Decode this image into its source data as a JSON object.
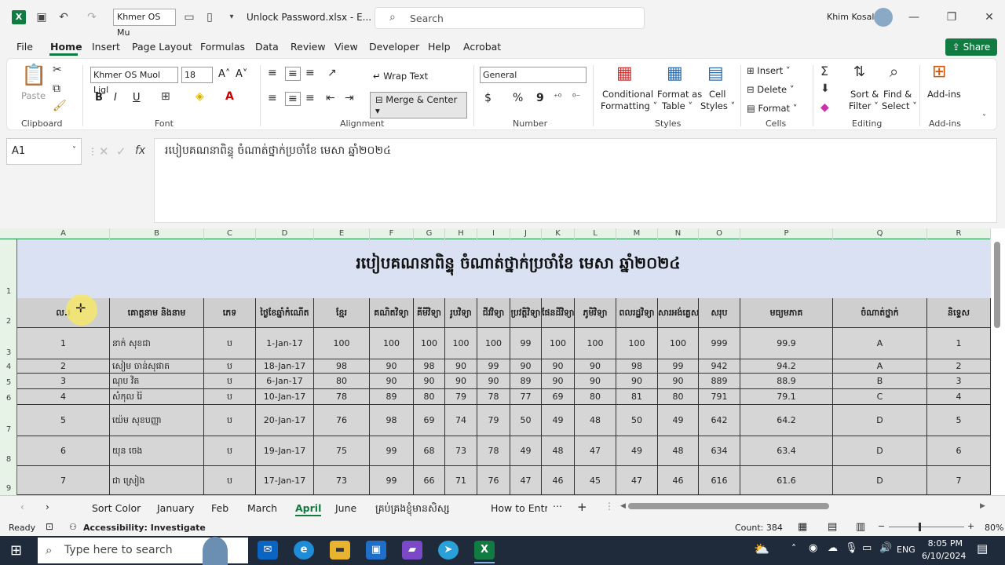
{
  "titlebar": {
    "font_name": "Khmer OS Mu",
    "file_name": "Unlock Password.xlsx",
    "file_suffix": "- E...",
    "search_placeholder": "Search",
    "user": "Khim Kosal"
  },
  "menu": [
    "File",
    "Home",
    "Insert",
    "Page Layout",
    "Formulas",
    "Data",
    "Review",
    "View",
    "Developer",
    "Help",
    "Acrobat"
  ],
  "share_label": "Share",
  "ribbon": {
    "clipboard": {
      "paste": "Paste",
      "label": "Clipboard"
    },
    "font": {
      "name": "Khmer OS Muol Ligl",
      "size": "18",
      "bold": "B",
      "italic": "I",
      "underline": "U",
      "label": "Font"
    },
    "alignment": {
      "wrap": "Wrap Text",
      "merge": "Merge & Center",
      "label": "Alignment"
    },
    "number": {
      "format": "General",
      "currency": "$",
      "percent": "%",
      "comma": "9",
      "label": "Number"
    },
    "styles": {
      "conditional": "Conditional",
      "formatting": "Formatting",
      "format_as": "Format as",
      "table": "Table",
      "cell": "Cell",
      "styles": "Styles",
      "label": "Styles"
    },
    "cells": {
      "insert": "Insert",
      "delete": "Delete",
      "format": "Format",
      "label": "Cells"
    },
    "editing": {
      "sort": "Sort &",
      "filter": "Filter",
      "find": "Find &",
      "select": "Select",
      "label": "Editing"
    },
    "addins": {
      "name": "Add-ins",
      "label": "Add-ins"
    }
  },
  "formula_bar": {
    "cell_ref": "A1",
    "fx": "fx",
    "content": "របៀបគណនាពិន្ទុ ចំណាត់ថ្នាក់ប្រចាំខែ មេសា ឆ្នាំ២០២៤"
  },
  "sheet": {
    "columns": [
      "A",
      "B",
      "C",
      "D",
      "E",
      "F",
      "G",
      "H",
      "I",
      "J",
      "K",
      "L",
      "M",
      "N",
      "O",
      "P",
      "Q",
      "R"
    ],
    "row_numbers": [
      "1",
      "2",
      "3",
      "4",
      "5",
      "6",
      "7",
      "8",
      "9"
    ],
    "title": "របៀបគណនាពិន្ទុ ចំណាត់ថ្នាក់ប្រចាំខែ មេសា ឆ្នាំ២០២៤",
    "headers": [
      "ល.រ",
      "គោត្តនាម និងនាម",
      "ភេទ",
      "ថ្ងៃខែឆ្នាំកំណើត",
      "ខ្មែរ",
      "គណិតវិទ្យា",
      "គីមីវិទ្យា",
      "រូបវិទ្យា",
      "ជីវវិទ្យា",
      "ប្រវត្តិវិទ្យា",
      "ផែនដីវិទ្យា",
      "ភូមិវិទ្យា",
      "ពលរដ្ឋវិទ្យា",
      "សារអង់គ្លេស",
      "សរុប",
      "មធ្យមភាគ",
      "ចំណាត់ថ្នាក់",
      "និទ្ទេស"
    ],
    "rows": [
      [
        "1",
        "នាក់ សុខជា",
        "ប",
        "1-Jan-17",
        "100",
        "100",
        "100",
        "100",
        "100",
        "99",
        "100",
        "100",
        "100",
        "100",
        "999",
        "99.9",
        "A",
        "1"
      ],
      [
        "2",
        "សៀម ចាន់សុផាត",
        "ប",
        "18-Jan-17",
        "98",
        "90",
        "98",
        "90",
        "99",
        "90",
        "90",
        "90",
        "98",
        "99",
        "942",
        "94.2",
        "A",
        "2"
      ],
      [
        "3",
        "ណុប វិត",
        "ប",
        "6-Jan-17",
        "80",
        "90",
        "90",
        "90",
        "90",
        "89",
        "90",
        "90",
        "90",
        "90",
        "889",
        "88.9",
        "B",
        "3"
      ],
      [
        "4",
        "សំកុល រ៉ៃ",
        "ប",
        "10-Jan-17",
        "78",
        "89",
        "80",
        "79",
        "78",
        "77",
        "69",
        "80",
        "81",
        "80",
        "791",
        "79.1",
        "C",
        "4"
      ],
      [
        "5",
        "យ៉េម សុខបញ្ញា",
        "ប",
        "20-Jan-17",
        "76",
        "98",
        "69",
        "74",
        "79",
        "50",
        "49",
        "48",
        "50",
        "49",
        "642",
        "64.2",
        "D",
        "5"
      ],
      [
        "6",
        "យុន ចេង",
        "ប",
        "19-Jan-17",
        "75",
        "99",
        "68",
        "73",
        "78",
        "49",
        "48",
        "47",
        "49",
        "48",
        "634",
        "63.4",
        "D",
        "6"
      ],
      [
        "7",
        "ជា ស្រៀង",
        "ប",
        "17-Jan-17",
        "73",
        "99",
        "66",
        "71",
        "76",
        "47",
        "46",
        "45",
        "47",
        "46",
        "616",
        "61.6",
        "D",
        "7"
      ]
    ]
  },
  "tabs": [
    "Sort Color",
    "January",
    "Feb",
    "March",
    "April",
    "June",
    "គ្រប់គ្រងខ្ញុំមានសិស្ស",
    "How to Entr"
  ],
  "active_tab": "April",
  "status": {
    "ready": "Ready",
    "accessibility": "Accessibility: Investigate",
    "count": "Count: 384",
    "zoom": "80%"
  },
  "taskbar": {
    "search_placeholder": "Type here to search",
    "lang": "ENG",
    "time": "8:05 PM",
    "date": "6/10/2024"
  }
}
